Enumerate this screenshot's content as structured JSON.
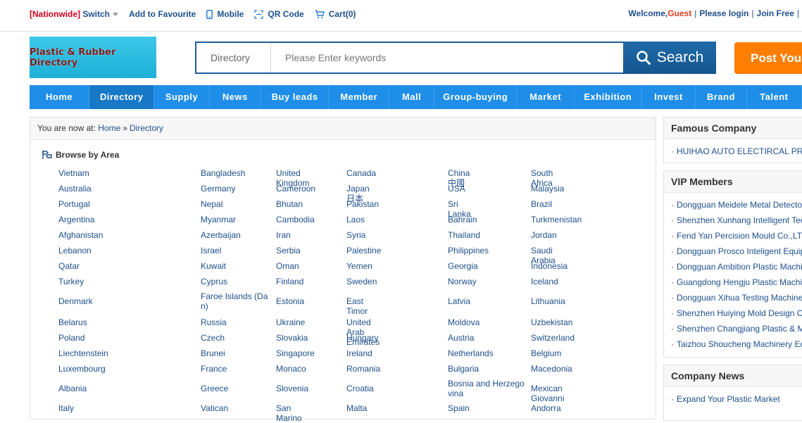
{
  "topbar": {
    "nationwide": "[Nationwide]",
    "switch": "Switch",
    "favourite": "Add to Favourite",
    "mobile": "Mobile",
    "qrcode": "QR Code",
    "cart": "Cart(0)",
    "welcome": "Welcome,",
    "guest": "Guest",
    "login": "Please login",
    "join": "Join Free"
  },
  "logo": {
    "text": "Plastic & Rubber Directory"
  },
  "search": {
    "category": "Directory",
    "placeholder": "Please Enter keywords",
    "button": "Search"
  },
  "post_button": "Post Your",
  "nav": [
    {
      "label": "Home",
      "width": 87
    },
    {
      "label": "Directory",
      "width": 94
    },
    {
      "label": "Supply",
      "width": 80
    },
    {
      "label": "News",
      "width": 75
    },
    {
      "label": "Buy leads",
      "width": 98
    },
    {
      "label": "Member",
      "width": 88
    },
    {
      "label": "Mall",
      "width": 65
    },
    {
      "label": "Group-buying",
      "width": 120
    },
    {
      "label": "Market",
      "width": 83
    },
    {
      "label": "Exhibition",
      "width": 98
    },
    {
      "label": "Invest",
      "width": 78
    },
    {
      "label": "Brand",
      "width": 74
    },
    {
      "label": "Talent",
      "width": 80
    }
  ],
  "breadcrumb": {
    "prefix": "You are now at:",
    "home": "Home",
    "separator": "»",
    "current": "Directory"
  },
  "browse": {
    "title": "Browse by Area",
    "rows": [
      [
        "Vietnam",
        "Bangladesh",
        "United Kingdom",
        "Canada",
        "China中國",
        "South Africa"
      ],
      [
        "Australia",
        "Germany",
        "Cameroon",
        "Japan日本",
        "USA",
        "Malaysia"
      ],
      [
        "Portugal",
        "Nepal",
        "Bhutan",
        "Pakistan",
        "Sri Lanka",
        "Brazil"
      ],
      [
        "Argentina",
        "Myanmar",
        "Cambodia",
        "Laos",
        "Bahrain",
        "Turkmenistan"
      ],
      [
        "Afghanistan",
        "Azerbaijan",
        "Iran",
        "Syria",
        "Thailand",
        "Jordan"
      ],
      [
        "Lebanon",
        "Israel",
        "Serbia",
        "Palestine",
        "Philippines",
        "Saudi Arabia"
      ],
      [
        "Qatar",
        "Kuwait",
        "Oman",
        "Yemen",
        "Georgia",
        "Indonesia"
      ],
      [
        "Turkey",
        "Cyprus",
        "Finland",
        "Sweden",
        "Norway",
        "Iceland"
      ],
      [
        "Denmark",
        "Faroe Islands (Dan)",
        "Estonia",
        "East Timor",
        "Latvia",
        "Lithuania"
      ],
      [
        "Belarus",
        "Russia",
        "Ukraine",
        "United Arab Emirates",
        "Moldova",
        "Uzbekistan"
      ],
      [
        "Poland",
        "Czech",
        "Slovakia",
        "Hungary",
        "Austria",
        "Switzerland"
      ],
      [
        "Liechtenstein",
        "Brunei",
        "Singapore",
        "Ireland",
        "Netherlands",
        "Belgium"
      ],
      [
        "Luxembourg",
        "France",
        "Monaco",
        "Romania",
        "Bulgaria",
        "Macedonia"
      ],
      [
        "Albania",
        "Greece",
        "Slovenia",
        "Croatia",
        "Bosnia and Herzegovina",
        "Mexican Giovanni"
      ],
      [
        "Italy",
        "Vatican",
        "San Marino",
        "Malta",
        "Spain",
        "Andorra"
      ]
    ]
  },
  "famous": {
    "title": "Famous Company",
    "items": [
      "HUIHAO AUTO ELECTIRCAL PRODUCTS"
    ]
  },
  "vip": {
    "title": "VIP Members",
    "items": [
      "Dongguan Meidele Metal Detector",
      "Shenzhen Xunhang Intelligent Tech",
      "Fend Yan Percision Mould Co.,LTD",
      "Dongguan Prosco Inteligent Equip",
      "Dongguan Ambition Plastic Machinery",
      "Guangdong Hengju Plastic Machinery",
      "Dongguan Xihua Testing Machine",
      "Shenzhen Huiying Mold Design Co",
      "Shenzhen Changjiang Plastic & Metal",
      "Taizhou Shoucheng Machinery Equip"
    ]
  },
  "news": {
    "title": "Company News",
    "items": [
      "Expand Your Plastic Market"
    ]
  }
}
